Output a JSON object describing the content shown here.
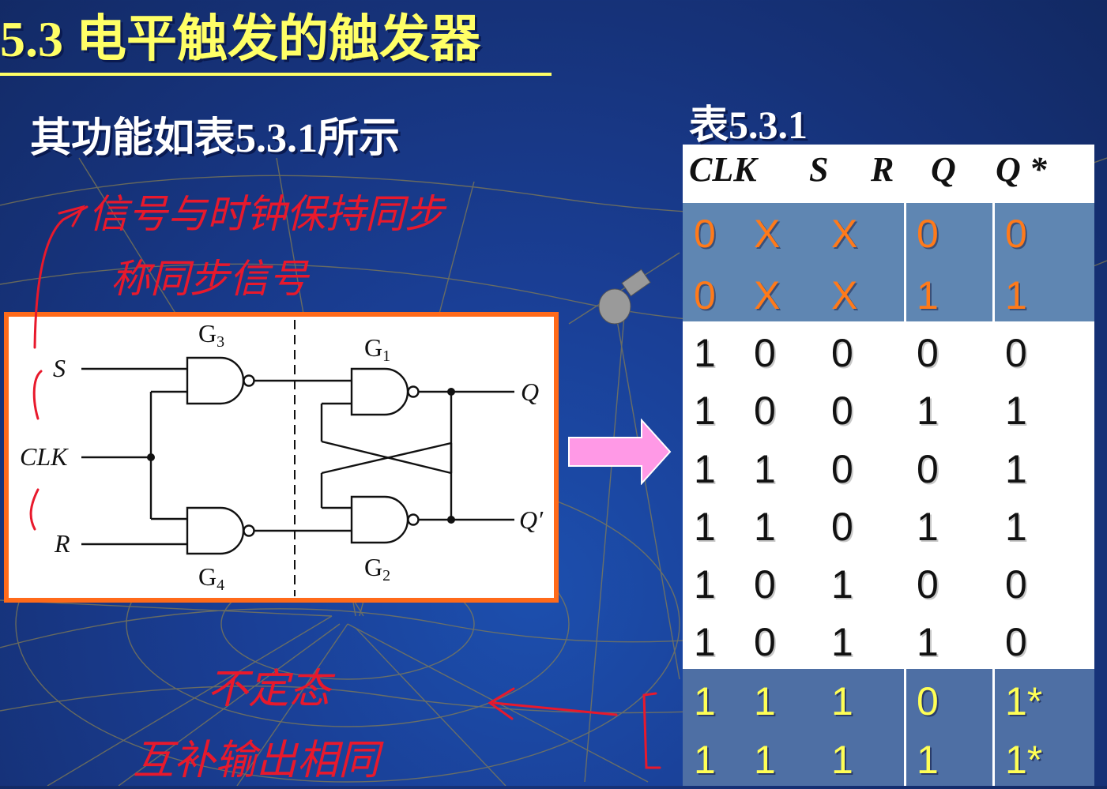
{
  "slide": {
    "title": "5.3 电平触发的触发器",
    "subtitle": "其功能如表5.3.1所示"
  },
  "table": {
    "caption": "表5.3.1",
    "headers": [
      "CLK",
      "S",
      "R",
      "Q",
      "Q *"
    ],
    "rows": [
      [
        "0",
        "X",
        "X",
        "0",
        "0"
      ],
      [
        "0",
        "X",
        "X",
        "1",
        "1"
      ],
      [
        "1",
        "0",
        "0",
        "0",
        "0"
      ],
      [
        "1",
        "0",
        "0",
        "1",
        "1"
      ],
      [
        "1",
        "1",
        "0",
        "0",
        "1"
      ],
      [
        "1",
        "1",
        "0",
        "1",
        "1"
      ],
      [
        "1",
        "0",
        "1",
        "0",
        "0"
      ],
      [
        "1",
        "0",
        "1",
        "1",
        "0"
      ],
      [
        "1",
        "1",
        "1",
        "0",
        "1*"
      ],
      [
        "1",
        "1",
        "1",
        "1",
        "1*"
      ]
    ]
  },
  "circuit": {
    "inputs": {
      "s": "S",
      "clk": "CLK",
      "r": "R"
    },
    "outputs": {
      "q": "Q",
      "q_prime": "Q′"
    },
    "gates": {
      "g3": "G",
      "g3_sub": "3",
      "g4": "G",
      "g4_sub": "4",
      "g1": "G",
      "g1_sub": "1",
      "g2": "G",
      "g2_sub": "2"
    }
  },
  "annotations": {
    "handwritten_1": "信号与时钟保持同步",
    "handwritten_2": "称同步信号",
    "handwritten_3": "不定态",
    "handwritten_4": "互补输出相同"
  },
  "colors": {
    "title": "#ffff66",
    "diagram_border": "#ff6a1a",
    "arrow_fill": "#ff99e6",
    "ink": "#e8192c"
  }
}
